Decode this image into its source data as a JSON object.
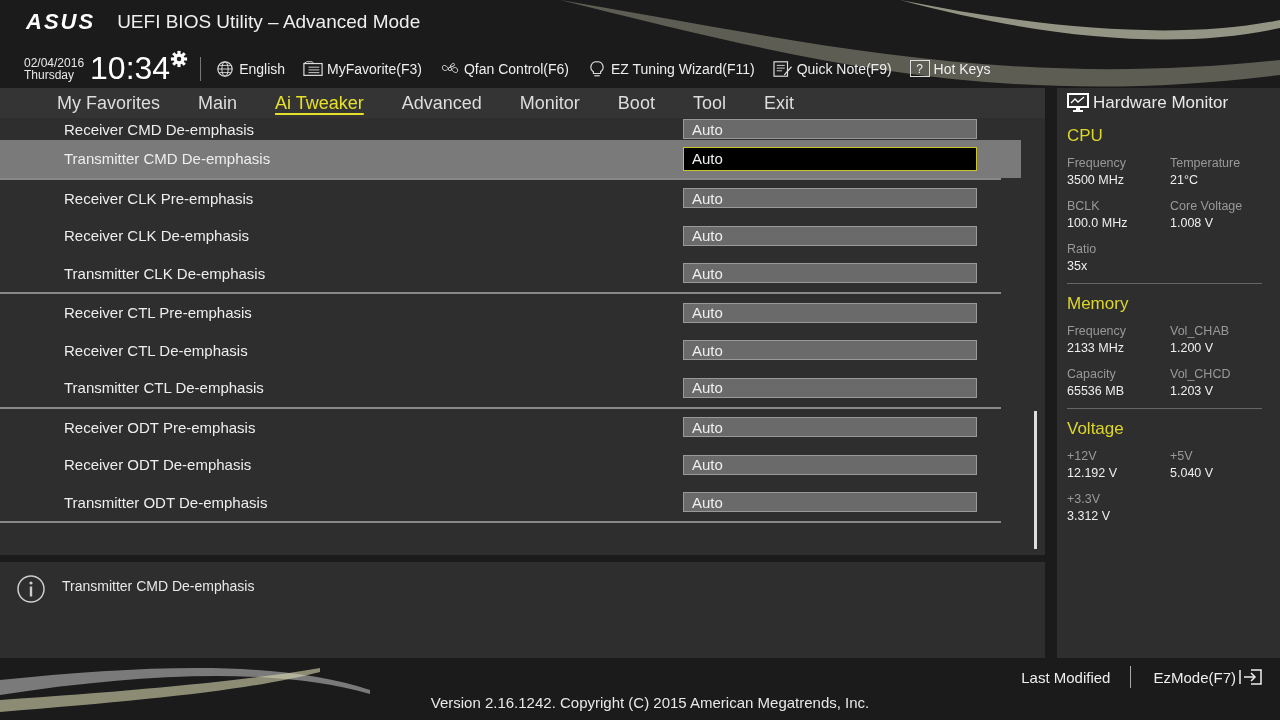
{
  "header": {
    "logo": "ASUS",
    "title": "UEFI BIOS Utility – Advanced Mode",
    "date": "02/04/2016",
    "weekday": "Thursday",
    "time": "10:34",
    "tools": [
      {
        "kind": "globe",
        "label": "English"
      },
      {
        "kind": "favorite",
        "label": "MyFavorite(F3)"
      },
      {
        "kind": "fan",
        "label": "Qfan Control(F6)"
      },
      {
        "kind": "bulb",
        "label": "EZ Tuning Wizard(F11)"
      },
      {
        "kind": "note",
        "label": "Quick Note(F9)"
      },
      {
        "kind": "help",
        "icon_text": "?",
        "label": "Hot Keys"
      }
    ]
  },
  "tabs": [
    {
      "label": "My Favorites",
      "selected": false
    },
    {
      "label": "Main",
      "selected": false
    },
    {
      "label": "Ai Tweaker",
      "selected": true
    },
    {
      "label": "Advanced",
      "selected": false
    },
    {
      "label": "Monitor",
      "selected": false
    },
    {
      "label": "Boot",
      "selected": false
    },
    {
      "label": "Tool",
      "selected": false
    },
    {
      "label": "Exit",
      "selected": false
    }
  ],
  "settings": [
    [
      {
        "label": "Receiver CMD De-emphasis",
        "value": "Auto",
        "selected": false
      },
      {
        "label": "Transmitter CMD De-emphasis",
        "value": "Auto",
        "selected": true
      }
    ],
    [
      {
        "label": "Receiver CLK Pre-emphasis",
        "value": "Auto",
        "selected": false
      },
      {
        "label": "Receiver CLK De-emphasis",
        "value": "Auto",
        "selected": false
      },
      {
        "label": "Transmitter CLK De-emphasis",
        "value": "Auto",
        "selected": false
      }
    ],
    [
      {
        "label": "Receiver CTL Pre-emphasis",
        "value": "Auto",
        "selected": false
      },
      {
        "label": "Receiver CTL De-emphasis",
        "value": "Auto",
        "selected": false
      },
      {
        "label": "Transmitter CTL De-emphasis",
        "value": "Auto",
        "selected": false
      }
    ],
    [
      {
        "label": "Receiver ODT Pre-emphasis",
        "value": "Auto",
        "selected": false
      },
      {
        "label": "Receiver ODT De-emphasis",
        "value": "Auto",
        "selected": false
      },
      {
        "label": "Transmitter ODT De-emphasis",
        "value": "Auto",
        "selected": false
      }
    ]
  ],
  "help_text": "Transmitter CMD De-emphasis",
  "hardware_monitor": {
    "title": "Hardware Monitor",
    "sections": [
      {
        "title": "CPU",
        "items": [
          {
            "label": "Frequency",
            "value": "3500 MHz"
          },
          {
            "label": "Temperature",
            "value": "21°C"
          },
          {
            "label": "BCLK",
            "value": "100.0 MHz"
          },
          {
            "label": "Core Voltage",
            "value": "1.008 V"
          },
          {
            "label": "Ratio",
            "value": "35x"
          }
        ]
      },
      {
        "title": "Memory",
        "items": [
          {
            "label": "Frequency",
            "value": "2133 MHz"
          },
          {
            "label": "Vol_CHAB",
            "value": "1.200 V"
          },
          {
            "label": "Capacity",
            "value": "65536 MB"
          },
          {
            "label": "Vol_CHCD",
            "value": "1.203 V"
          }
        ]
      },
      {
        "title": "Voltage",
        "items": [
          {
            "label": "+12V",
            "value": "12.192 V"
          },
          {
            "label": "+5V",
            "value": "5.040 V"
          },
          {
            "label": "+3.3V",
            "value": "3.312 V"
          }
        ]
      }
    ]
  },
  "footer": {
    "last_modified": "Last Modified",
    "ez_mode": "EzMode(F7)",
    "version": "Version 2.16.1242. Copyright (C) 2015 American Megatrends, Inc."
  }
}
